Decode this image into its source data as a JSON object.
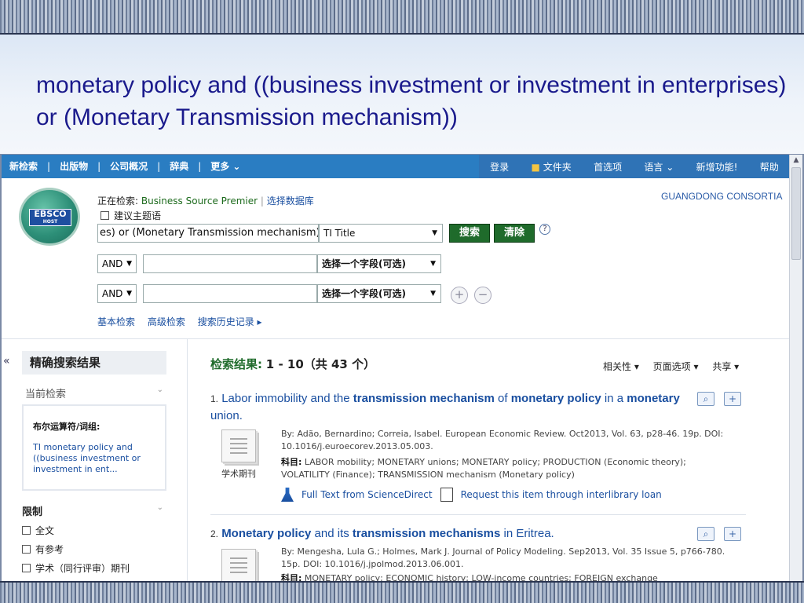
{
  "slide": {
    "title": "monetary policy and ((business investment or investment in enterprises) or (Monetary Transmission mechanism))"
  },
  "nav": {
    "left": [
      "新检索",
      "出版物",
      "公司概况",
      "辞典",
      "更多 ⌄"
    ],
    "right": [
      "登录",
      "文件夹",
      "首选项",
      "语言 ⌄",
      "新增功能!",
      "帮助"
    ]
  },
  "logo": {
    "line1": "EBSCO",
    "line2": "HOST"
  },
  "search": {
    "searching_label": "正在检索:",
    "database": "Business Source Premier",
    "choose_db": "选择数据库",
    "consortia": "GUANGDONG CONSORTIA",
    "suggest_label": "建议主题语",
    "query": "es) or (Monetary Transmission mechanism))",
    "field1": "TI Title",
    "search_btn": "搜索",
    "clear_btn": "清除",
    "help": "?",
    "bool1": "AND",
    "bool2": "AND",
    "field_placeholder": "选择一个字段(可选)",
    "add": "+",
    "remove": "−",
    "links": [
      "基本检索",
      "高级检索",
      "搜索历史记录 ▸"
    ]
  },
  "sidebar": {
    "collapse": "«",
    "title": "精确搜索结果",
    "current_label": "当前检索",
    "bool_label": "布尔运算符/词组:",
    "current_query": "TI monetary policy and ((business investment or investment in ent...",
    "limit_label": "限制",
    "options": [
      "全文",
      "有参考",
      "学术（同行评审）期刊"
    ]
  },
  "results": {
    "header_label": "检索结果:",
    "header_range": "1 - 10（共 43 个）",
    "tools": [
      "相关性 ▾",
      "页面选项 ▾",
      "共享 ▾"
    ],
    "items": [
      {
        "num": "1.",
        "title_html_parts": [
          "Labor immobility and the ",
          "transmission mechanism",
          " of ",
          "monetary policy",
          " in a ",
          "monetary",
          " union."
        ],
        "byline": "By: Adão, Bernardino; Correia, Isabel. European Economic Review. Oct2013, Vol. 63, p28-46. 19p. DOI: 10.1016/j.euroecorev.2013.05.003.",
        "subjects_label": "科目:",
        "subjects": "LABOR mobility; MONETARY unions; MONETARY policy; PRODUCTION (Economic theory); VOLATILITY (Finance); TRANSMISSION mechanism (Monetary policy)",
        "pubtype": "学术期刊",
        "fulltext": "Full Text from ScienceDirect",
        "ill": "Request this item through interlibrary loan"
      },
      {
        "num": "2.",
        "title_html_parts": [
          "Monetary policy",
          " and its ",
          "transmission mechanisms",
          " in Eritrea."
        ],
        "byline": "By: Mengesha, Lula G.; Holmes, Mark J. Journal of Policy Modeling. Sep2013, Vol. 35 Issue 5, p766-780. 15p. DOI: 10.1016/j.jpolmod.2013.06.001.",
        "subjects_label": "科目:",
        "subjects": "MONETARY policy; ECONOMIC history; LOW-income countries; FOREIGN exchange"
      }
    ]
  }
}
